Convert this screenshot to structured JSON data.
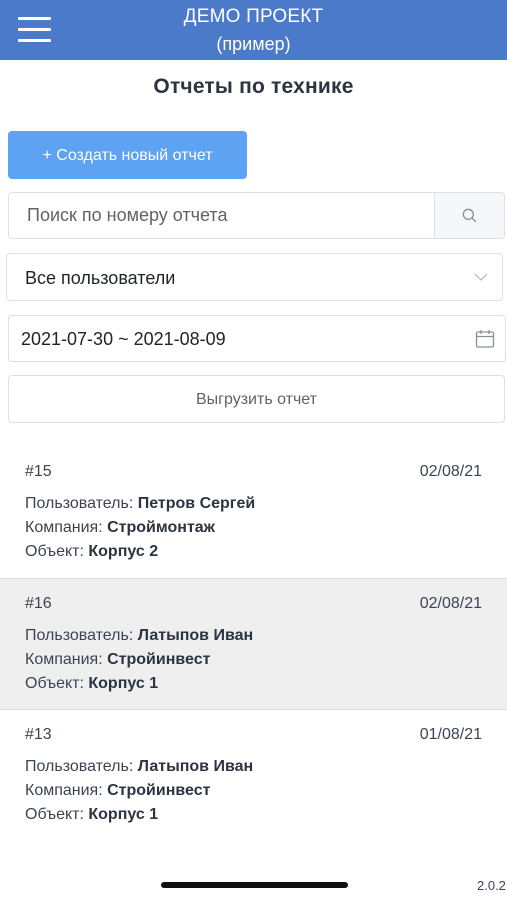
{
  "header": {
    "title": "ДЕМО ПРОЕКТ",
    "subtitle": "(пример)"
  },
  "page": {
    "title": "Отчеты по технике"
  },
  "toolbar": {
    "create_label": "+ Создать новый отчет",
    "export_label": "Выгрузить отчет"
  },
  "search": {
    "placeholder": "Поиск по номеру отчета",
    "value": ""
  },
  "filters": {
    "user_selected": "Все пользователи",
    "date_range": "2021-07-30 ~ 2021-08-09"
  },
  "labels": {
    "user": "Пользователь: ",
    "company": "Компания: ",
    "object": "Объект: "
  },
  "reports": [
    {
      "number": "#15",
      "date": "02/08/21",
      "user": "Петров Сергей",
      "company": "Строймонтаж",
      "object": "Корпус 2"
    },
    {
      "number": "#16",
      "date": "02/08/21",
      "user": "Латыпов Иван",
      "company": "Стройинвест",
      "object": "Корпус 1"
    },
    {
      "number": "#13",
      "date": "01/08/21",
      "user": "Латыпов Иван",
      "company": "Стройинвест",
      "object": "Корпус 1"
    }
  ],
  "footer": {
    "version": "2.0.2"
  },
  "colors": {
    "header": "#4a7ac9",
    "primary_button": "#5ea3f2",
    "selected_row": "#efefef"
  }
}
